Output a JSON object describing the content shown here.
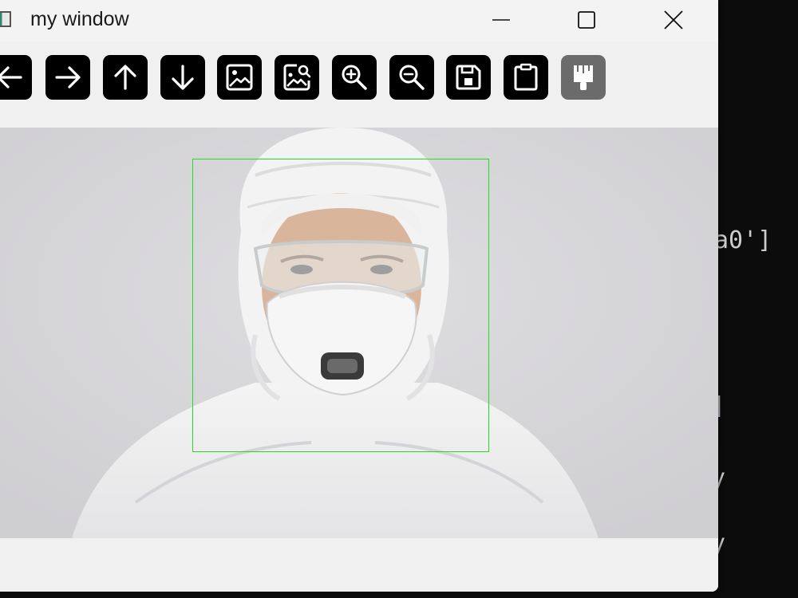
{
  "window": {
    "title": "my window"
  },
  "terminal": {
    "lines": [
      "a0']",
      "]",
      "y",
      "y"
    ]
  },
  "toolbar": {
    "buttons": [
      {
        "name": "pan-left",
        "icon": "arrow-left-icon",
        "enabled": true
      },
      {
        "name": "pan-right",
        "icon": "arrow-right-icon",
        "enabled": true
      },
      {
        "name": "pan-up",
        "icon": "arrow-up-icon",
        "enabled": true
      },
      {
        "name": "pan-down",
        "icon": "arrow-down-icon",
        "enabled": true
      },
      {
        "name": "zoom-to-image",
        "icon": "image-icon",
        "enabled": true
      },
      {
        "name": "zoom-to-region",
        "icon": "image-search-icon",
        "enabled": true
      },
      {
        "name": "zoom-in",
        "icon": "zoom-in-icon",
        "enabled": true
      },
      {
        "name": "zoom-out",
        "icon": "zoom-out-icon",
        "enabled": true
      },
      {
        "name": "save",
        "icon": "save-icon",
        "enabled": true
      },
      {
        "name": "copy-to-clipboard",
        "icon": "clipboard-icon",
        "enabled": true
      },
      {
        "name": "properties",
        "icon": "paintbrush-icon",
        "enabled": false
      }
    ]
  },
  "image": {
    "description_icon": "person-in-protective-suit-photo",
    "detection_box_color": "#22dd22"
  },
  "colors": {
    "window_bg": "#f0f0f0",
    "canvas_bg": "#d6d5d8",
    "terminal_bg": "#0c0c0c",
    "toolbar_button": "#000000",
    "toolbar_button_disabled": "#6b6b6b"
  }
}
